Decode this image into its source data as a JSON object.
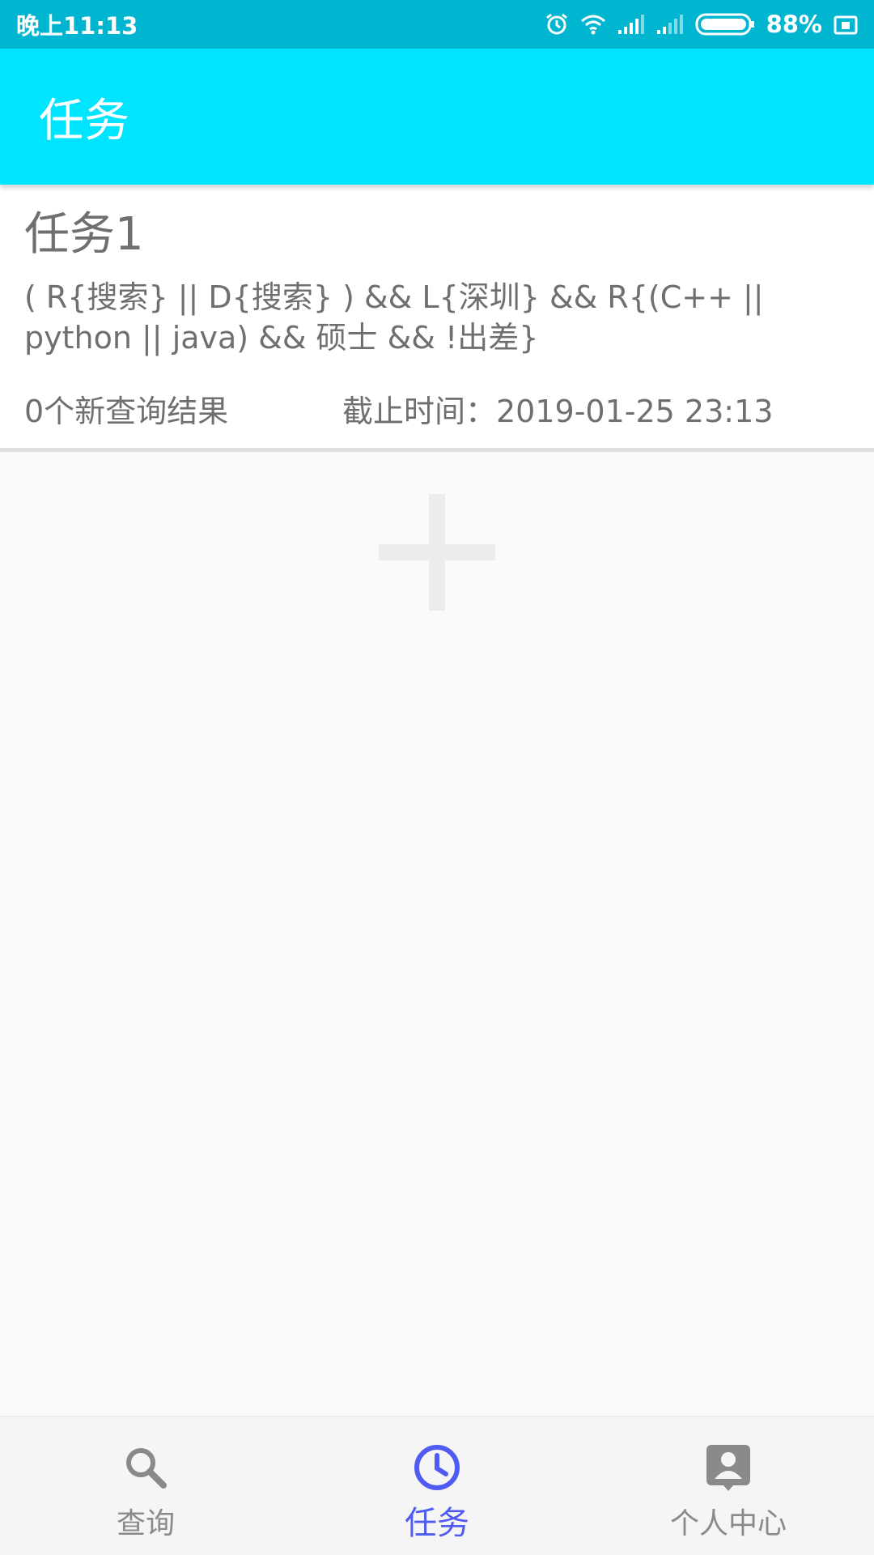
{
  "status_bar": {
    "time": "晚上11:13",
    "battery_percent": "88%",
    "icons": [
      "alarm-icon",
      "wifi-icon",
      "signal-icon",
      "signal-icon",
      "battery-icon",
      "screen-icon"
    ],
    "color": "#00b5cf"
  },
  "app_bar": {
    "title": "任务",
    "color": "#00e5ff"
  },
  "tasks": [
    {
      "name": "任务1",
      "query": "( R{搜索} || D{搜索} ) && L{深圳} && R{(C++ || python || java) && 硕士 && !出差}",
      "new_results": "0个新查询结果",
      "deadline": "截止时间：2019-01-25 23:13"
    }
  ],
  "add_button": {
    "icon": "plus-icon"
  },
  "bottom_nav": {
    "active_color": "#4f5bf2",
    "items": [
      {
        "label": "查询",
        "icon": "search-icon",
        "active": false
      },
      {
        "label": "任务",
        "icon": "clock-icon",
        "active": true
      },
      {
        "label": "个人中心",
        "icon": "person-icon",
        "active": false
      }
    ]
  }
}
